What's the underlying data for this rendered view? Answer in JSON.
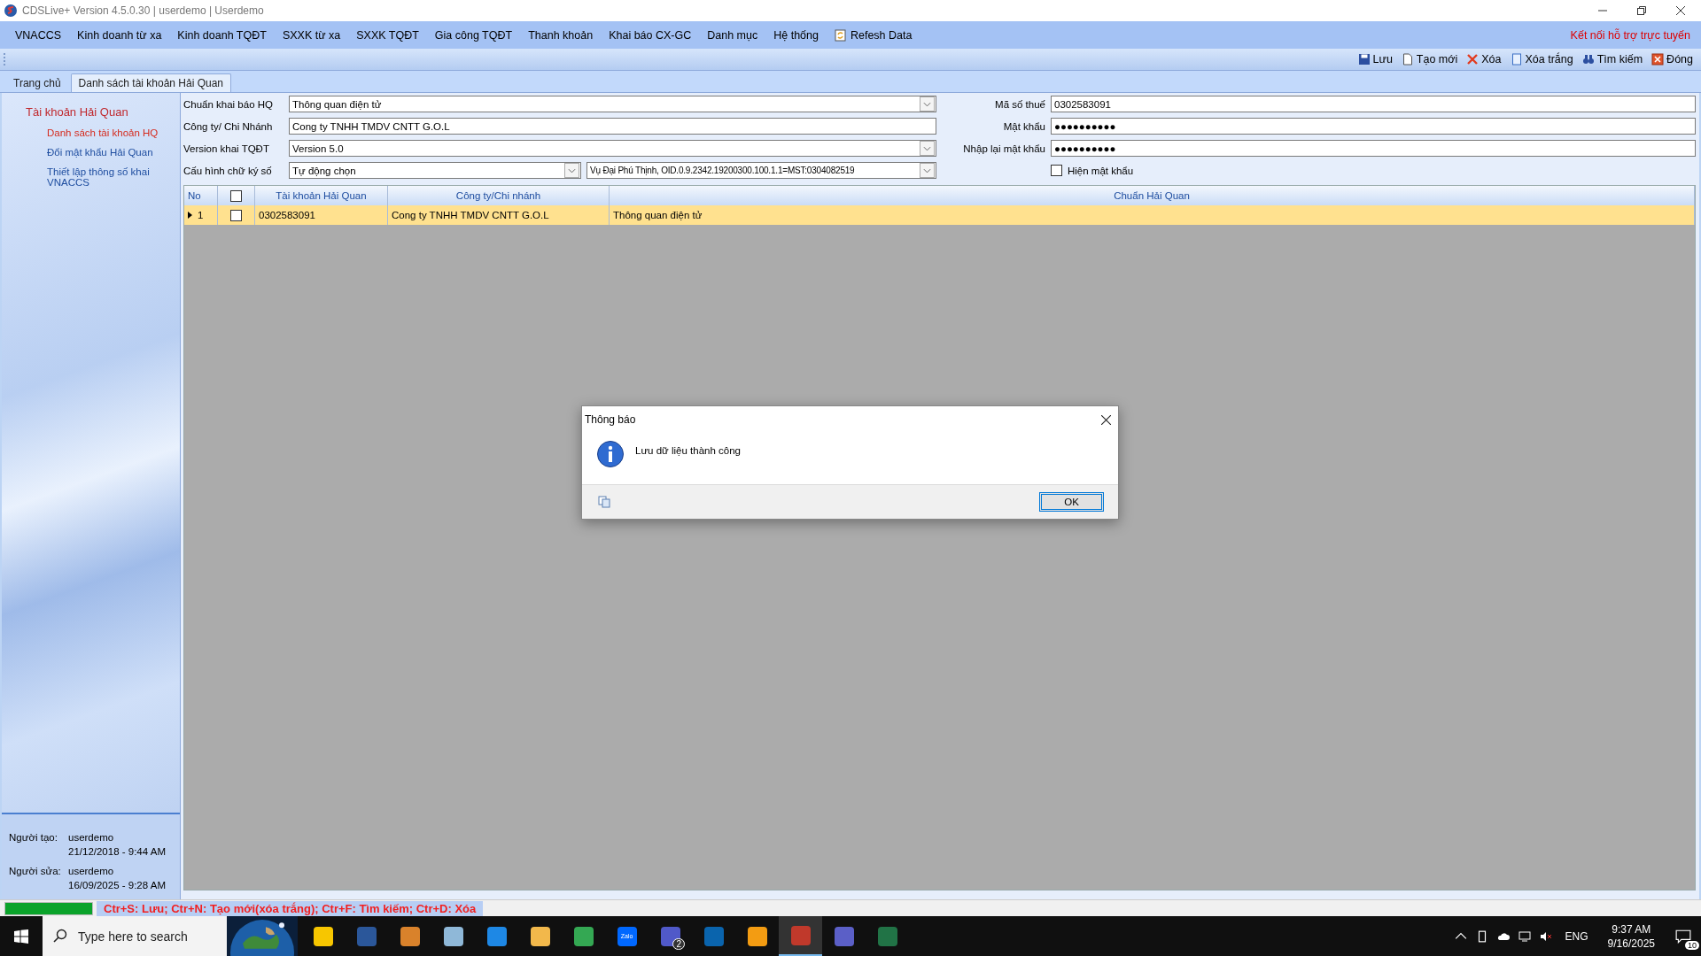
{
  "window": {
    "title": "CDSLive+ Version 4.5.0.30 | userdemo | Userdemo"
  },
  "menu": [
    {
      "label": "VNACCS",
      "kind": "text"
    },
    {
      "label": "Kinh doanh từ xa",
      "kind": "text"
    },
    {
      "label": "Kinh doanh TQĐT",
      "kind": "text"
    },
    {
      "label": "SXXK từ xa",
      "kind": "text"
    },
    {
      "label": "SXXK TQĐT",
      "kind": "text"
    },
    {
      "label": "Gia công TQĐT",
      "kind": "text"
    },
    {
      "label": "Thanh khoản",
      "kind": "text"
    },
    {
      "label": "Khai báo CX-GC",
      "kind": "text"
    },
    {
      "label": "Danh mục",
      "kind": "text"
    },
    {
      "label": "Hệ thống",
      "kind": "text"
    },
    {
      "label": "Refesh Data",
      "kind": "refresh"
    }
  ],
  "support_link": "Kết nối hỗ trợ trực tuyến",
  "toolbar": [
    {
      "label": "Lưu",
      "kind": "save"
    },
    {
      "label": "Tạo mới",
      "kind": "new"
    },
    {
      "label": "Xóa",
      "kind": "delete"
    },
    {
      "label": "Xóa trắng",
      "kind": "clear"
    },
    {
      "label": "Tìm kiếm",
      "kind": "find"
    },
    {
      "label": "Đóng",
      "kind": "close"
    }
  ],
  "tabs": [
    {
      "label": "Trang chủ",
      "selected": false
    },
    {
      "label": "Danh sách tài khoản Hải Quan",
      "selected": true
    }
  ],
  "sidebar": {
    "title": "Tài khoản Hải Quan",
    "items": [
      {
        "label": "Danh sách tài khoản HQ",
        "selected": true
      },
      {
        "label": "Đổi mật khẩu Hải Quan",
        "selected": false
      },
      {
        "label": "Thiết lập thông số khai VNACCS",
        "selected": false
      }
    ],
    "info": [
      {
        "label": "Người tạo:",
        "user": "userdemo",
        "time": "21/12/2018 - 9:44 AM"
      },
      {
        "label": "Người sửa:",
        "user": "userdemo",
        "time": "16/09/2025 - 9:28 AM"
      }
    ]
  },
  "form_left": [
    {
      "label": "Chuẩn khai báo HQ",
      "kind": "select",
      "value": "Thông quan điện tử"
    },
    {
      "label": "Công ty/ Chi Nhánh",
      "kind": "text",
      "value": "Cong ty TNHH TMDV CNTT G.O.L"
    },
    {
      "label": "Version khai TQĐT",
      "kind": "select",
      "value": "Version 5.0"
    },
    {
      "label": "Cấu hình chữ ký số",
      "kind": "double",
      "value": "Tự động chọn",
      "value_2": "Vụ Đại Phú Thịnh, OID.0.9.2342.19200300.100.1.1=MST:0304082519"
    }
  ],
  "form_right": [
    {
      "label": "Mã số thuế",
      "value": "0302583091"
    },
    {
      "label": "Mật khẩu",
      "value": "●●●●●●●●●●"
    },
    {
      "label": "Nhập lại mật khẩu",
      "value": "●●●●●●●●●●"
    }
  ],
  "show_password": {
    "label": "Hiện mật khẩu",
    "checked": false
  },
  "table": {
    "columns": [
      "No",
      "Tài khoản Hải Quan",
      "Công ty/Chi nhánh",
      "Chuẩn Hải Quan"
    ],
    "header_checked": false,
    "rows": [
      {
        "no": "1",
        "checked": false,
        "selected": true,
        "account": "0302583091",
        "company": "Cong ty TNHH TMDV CNTT G.O.L",
        "standard": "Thông quan điện tử"
      }
    ]
  },
  "dialog": {
    "title": "Thông báo",
    "message": "Lưu dữ liệu thành công",
    "button": "OK"
  },
  "status_bar": {
    "level": 1,
    "text": "Ctr+S: Lưu; Ctr+N: Tạo mới(xóa trắng); Ctr+F: Tìm kiếm; Ctr+D: Xóa"
  },
  "taskbar": {
    "search": {
      "placeholder": "Type here to search"
    },
    "apps": [
      {
        "kind": "notes"
      },
      {
        "kind": "word"
      },
      {
        "kind": "compass"
      },
      {
        "kind": "book"
      },
      {
        "kind": "chat"
      },
      {
        "kind": "folder"
      },
      {
        "kind": "chrome"
      },
      {
        "kind": "zalo",
        "label": "Zalo"
      },
      {
        "kind": "teams",
        "badge": "2"
      },
      {
        "kind": "outlook"
      },
      {
        "kind": "orange"
      },
      {
        "kind": "cds",
        "selected": true
      },
      {
        "kind": "finder"
      },
      {
        "kind": "excel"
      }
    ],
    "language": "ENG",
    "time": "9:37 AM",
    "date": "9/16/2025",
    "notifications": "10"
  }
}
